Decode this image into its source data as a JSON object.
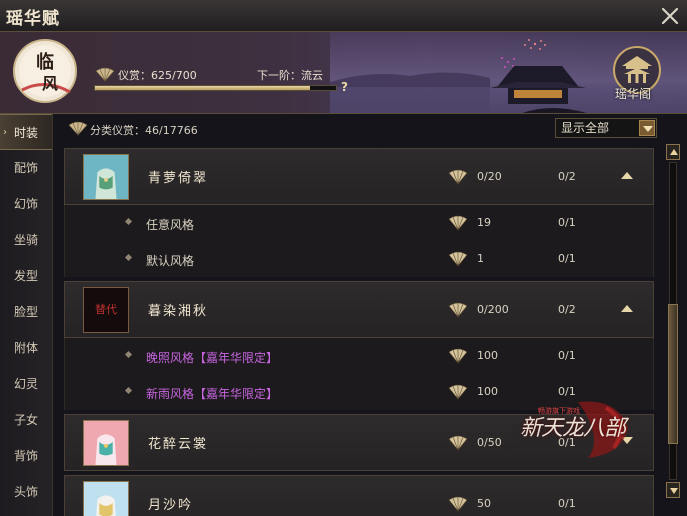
{
  "window": {
    "title": "瑶华赋"
  },
  "banner": {
    "rank_badge_text": "临风",
    "progress_label": "仪赏：625/700",
    "progress_value": 0.893,
    "next_tier_label": "下一阶：流云",
    "help_symbol": "?",
    "pavilion_label": "瑶华阁"
  },
  "sidebar": {
    "items": [
      {
        "label": "时装",
        "active": true
      },
      {
        "label": "配饰"
      },
      {
        "label": "幻饰"
      },
      {
        "label": "坐骑"
      },
      {
        "label": "发型"
      },
      {
        "label": "脸型"
      },
      {
        "label": "附体"
      },
      {
        "label": "幻灵"
      },
      {
        "label": "子女"
      },
      {
        "label": "背饰"
      },
      {
        "label": "头饰"
      }
    ]
  },
  "category": {
    "label": "分类仪赏：46/17766",
    "filter_selected": "显示全部"
  },
  "groups": [
    {
      "name": "青萝倚翠",
      "score": "0/20",
      "owned": "0/2",
      "expanded": true,
      "styles": [
        {
          "name": "任意风格",
          "score": "19",
          "owned": "0/1",
          "limited": false
        },
        {
          "name": "默认风格",
          "score": "1",
          "owned": "0/1",
          "limited": false
        }
      ]
    },
    {
      "name": "暮染湘秋",
      "thumb_text": "替代",
      "score": "0/200",
      "owned": "0/2",
      "expanded": true,
      "styles": [
        {
          "name": "晚照风格【嘉年华限定】",
          "score": "100",
          "owned": "0/1",
          "limited": true
        },
        {
          "name": "新雨风格【嘉年华限定】",
          "score": "100",
          "owned": "0/1",
          "limited": true
        }
      ]
    },
    {
      "name": "花醉云裳",
      "score": "0/50",
      "owned": "0/1",
      "expanded": false,
      "styles": []
    },
    {
      "name": "月沙吟",
      "score": "50",
      "owned": "0/1",
      "expanded": false,
      "styles": []
    }
  ],
  "watermark": {
    "small_text": "畅游旗下游戏",
    "big_text": "新天龙八部"
  },
  "colors": {
    "gold_accent": "#c8a86a",
    "limited_purple": "#c765e0",
    "text": "#d9d2c3"
  }
}
